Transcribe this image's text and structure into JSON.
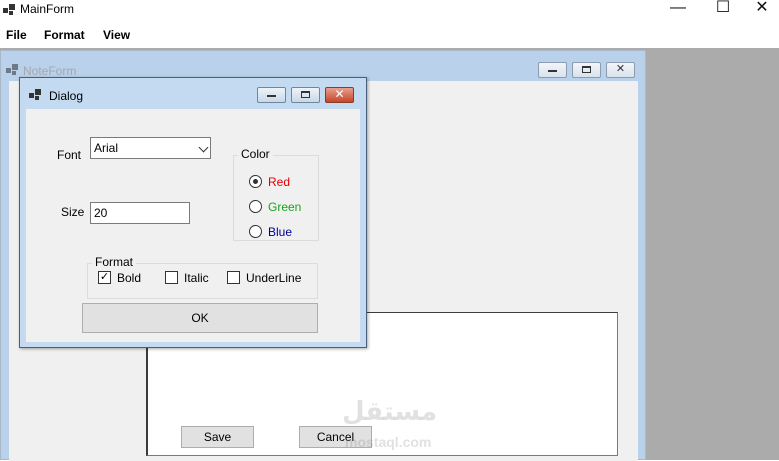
{
  "main_window": {
    "title": "MainForm",
    "buttons": {
      "minimize": "—",
      "maximize": "☐",
      "close": "✕"
    }
  },
  "menu": {
    "items": [
      "File",
      "Format",
      "View"
    ]
  },
  "note_form": {
    "title": "NoteForm",
    "save_button": "Save",
    "cancel_button": "Cancel"
  },
  "dialog": {
    "title": "Dialog",
    "font_label": "Font",
    "font_value": "Arial",
    "size_label": "Size",
    "size_value": "20",
    "color_group": {
      "legend": "Color",
      "options": [
        {
          "label": "Red",
          "color": "#e60000",
          "checked": true
        },
        {
          "label": "Green",
          "color": "#1aa31a",
          "checked": false
        },
        {
          "label": "Blue",
          "color": "#000099",
          "checked": false
        }
      ]
    },
    "format_group": {
      "legend": "Format",
      "options": [
        {
          "label": "Bold",
          "checked": true
        },
        {
          "label": "Italic",
          "checked": false
        },
        {
          "label": "UnderLine",
          "checked": false
        }
      ]
    },
    "ok_button": "OK"
  },
  "watermark": {
    "arabic": "مستقل",
    "latin": "mostaql.com"
  }
}
